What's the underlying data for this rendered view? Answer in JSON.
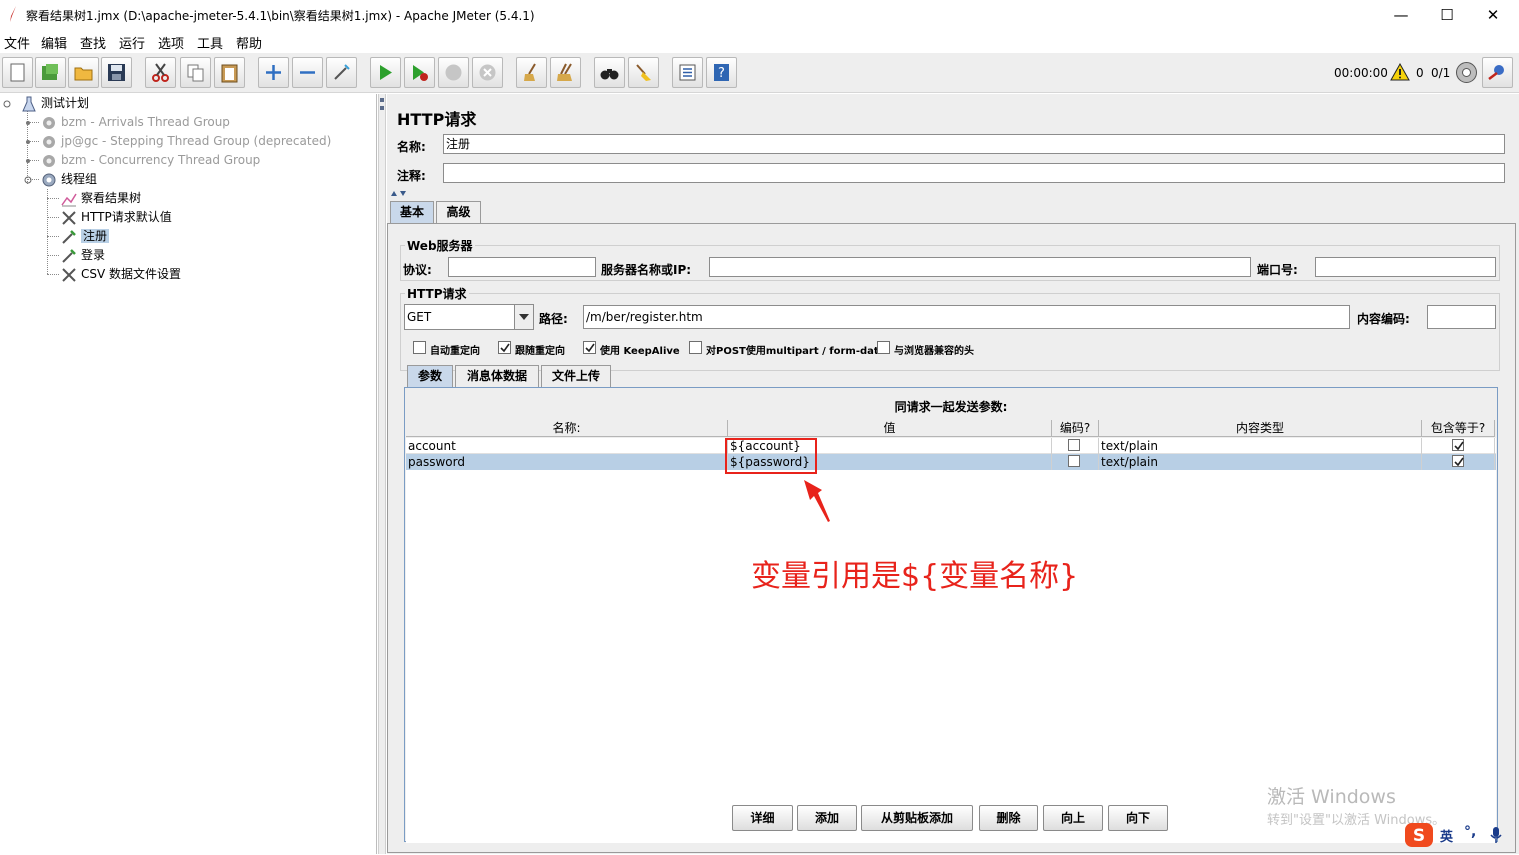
{
  "window": {
    "title": "察看结果树1.jmx (D:\\apache-jmeter-5.4.1\\bin\\察看结果树1.jmx) - Apache JMeter (5.4.1)",
    "minimize": "—",
    "maximize": "☐",
    "close": "✕"
  },
  "menu": [
    "文件",
    "编辑",
    "查找",
    "运行",
    "选项",
    "工具",
    "帮助"
  ],
  "toolbar": {
    "timer": "00:00:00",
    "warning_count": "0",
    "threads": "0/1"
  },
  "tree": {
    "root": "测试计划",
    "items": [
      {
        "label": "bzm - Arrivals Thread Group",
        "disabled": true
      },
      {
        "label": "jp@gc - Stepping Thread Group (deprecated)",
        "disabled": true
      },
      {
        "label": "bzm - Concurrency Thread Group",
        "disabled": true
      },
      {
        "label": "线程组",
        "disabled": false
      },
      {
        "label": "察看结果树",
        "disabled": false
      },
      {
        "label": "HTTP请求默认值",
        "disabled": false
      },
      {
        "label": "注册",
        "disabled": false,
        "selected": true
      },
      {
        "label": "登录",
        "disabled": false
      },
      {
        "label": "CSV 数据文件设置",
        "disabled": false
      }
    ]
  },
  "panel": {
    "title": "HTTP请求",
    "name_label": "名称:",
    "name_value": "注册",
    "comment_label": "注释:",
    "comment_value": "",
    "tabs": [
      "基本",
      "高级"
    ],
    "web_server": {
      "title": "Web服务器",
      "protocol_label": "协议:",
      "protocol_value": "",
      "server_label": "服务器名称或IP:",
      "server_value": "",
      "port_label": "端口号:",
      "port_value": ""
    },
    "http_request": {
      "title": "HTTP请求",
      "method": "GET",
      "path_label": "路径:",
      "path_value": "/m/ber/register.htm",
      "encoding_label": "内容编码:",
      "encoding_value": ""
    },
    "options": [
      {
        "label": "自动重定向",
        "checked": false
      },
      {
        "label": "跟随重定向",
        "checked": true
      },
      {
        "label": "使用 KeepAlive",
        "checked": true
      },
      {
        "label": "对POST使用multipart / form-data",
        "checked": false
      },
      {
        "label": "与浏览器兼容的头",
        "checked": false
      }
    ],
    "sub_tabs": [
      "参数",
      "消息体数据",
      "文件上传"
    ],
    "params": {
      "caption": "同请求一起发送参数:",
      "columns": [
        "名称:",
        "值",
        "编码?",
        "内容类型",
        "包含等于?"
      ],
      "rows": [
        {
          "name": "account",
          "value": "${account}",
          "encode": false,
          "content_type": "text/plain",
          "include_equals": true
        },
        {
          "name": "password",
          "value": "${password}",
          "encode": false,
          "content_type": "text/plain",
          "include_equals": true
        }
      ]
    },
    "buttons": [
      "详细",
      "添加",
      "从剪贴板添加",
      "删除",
      "向上",
      "向下"
    ]
  },
  "annotation": {
    "text": "变量引用是${变量名称}",
    "color": "#e8231b"
  },
  "watermark": {
    "line1": "激活 Windows",
    "line2": "转到\"设置\"以激活 Windows。"
  },
  "ime": {
    "lang": "英",
    "punct": "°,"
  }
}
